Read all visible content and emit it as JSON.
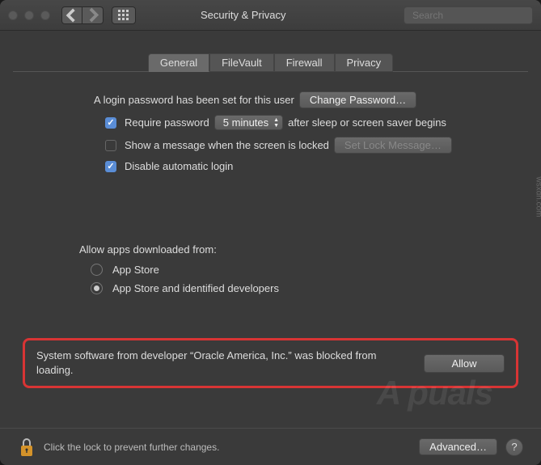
{
  "titlebar": {
    "title": "Security & Privacy",
    "search_placeholder": "Search"
  },
  "tabs": [
    {
      "label": "General",
      "active": true
    },
    {
      "label": "FileVault",
      "active": false
    },
    {
      "label": "Firewall",
      "active": false
    },
    {
      "label": "Privacy",
      "active": false
    }
  ],
  "login": {
    "password_set_text": "A login password has been set for this user",
    "change_password_btn": "Change Password…",
    "require_password_label": "Require password",
    "require_password_value": "5 minutes",
    "after_sleep_text": "after sleep or screen saver begins",
    "show_message_label": "Show a message when the screen is locked",
    "set_lock_message_btn": "Set Lock Message…",
    "disable_auto_login_label": "Disable automatic login"
  },
  "downloads": {
    "heading": "Allow apps downloaded from:",
    "option_appstore": "App Store",
    "option_identified": "App Store and identified developers"
  },
  "blocked": {
    "message": "System software from developer “Oracle America, Inc.” was blocked from loading.",
    "allow_btn": "Allow"
  },
  "footer": {
    "lock_text": "Click the lock to prevent further changes.",
    "advanced_btn": "Advanced…",
    "help": "?"
  },
  "watermark": "A puals",
  "url_mark": "wsxdn.com"
}
